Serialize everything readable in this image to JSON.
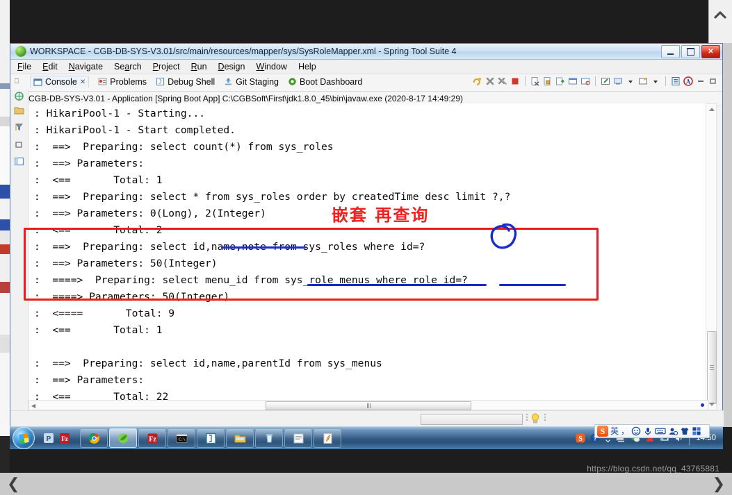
{
  "window": {
    "title": "WORKSPACE - CGB-DB-SYS-V3.01/src/main/resources/mapper/sys/SysRoleMapper.xml - Spring Tool Suite 4",
    "app_icon": "spring-leaf-icon",
    "buttons": {
      "minimize": "minimize-button",
      "restore": "restore-button",
      "close": "✕"
    }
  },
  "menubar": {
    "items": [
      {
        "label": "File",
        "mnemonic": "F"
      },
      {
        "label": "Edit",
        "mnemonic": "E"
      },
      {
        "label": "Navigate",
        "mnemonic": "N"
      },
      {
        "label": "Search",
        "mnemonic": "a"
      },
      {
        "label": "Project",
        "mnemonic": "P"
      },
      {
        "label": "Run",
        "mnemonic": "R"
      },
      {
        "label": "Design",
        "mnemonic": "D"
      },
      {
        "label": "Window",
        "mnemonic": "W"
      },
      {
        "label": "Help",
        "mnemonic": "H"
      }
    ]
  },
  "view_tabs": [
    {
      "label": "Console",
      "icon": "console-icon",
      "active": true,
      "close": "✕"
    },
    {
      "label": "Problems",
      "icon": "problems-icon",
      "active": false
    },
    {
      "label": "Debug Shell",
      "icon": "debug-shell-icon",
      "active": false
    },
    {
      "label": "Git Staging",
      "icon": "git-staging-icon",
      "active": false
    },
    {
      "label": "Boot Dashboard",
      "icon": "boot-dashboard-icon",
      "active": false
    }
  ],
  "toolbar_icons": [
    {
      "name": "relaunch-icon",
      "color": "#d9a227"
    },
    {
      "name": "terminate-icon",
      "color": "#8b8b8b"
    },
    {
      "name": "terminate-all-icon",
      "color": "#8b8b8b"
    },
    {
      "name": "stop-icon",
      "color": "#d8342a"
    },
    {
      "name": "remove-launch-icon",
      "color": "#8fa7c4"
    },
    {
      "name": "remove-all-terminated-icon",
      "color": "#d7a83a"
    },
    {
      "name": "scroll-lock-icon",
      "color": "#7ba05b"
    },
    {
      "name": "word-wrap-icon",
      "color": "#5b87c4"
    },
    {
      "name": "clear-console-icon",
      "color": "#c04a3a"
    },
    {
      "name": "pin-console-icon",
      "color": "#3f8f4d"
    },
    {
      "name": "display-selected-console-icon",
      "color": "#6b8fb8"
    },
    {
      "name": "display-dropdown-icon",
      "color": "#333333"
    },
    {
      "name": "open-console-icon",
      "color": "#d6b34a"
    },
    {
      "name": "open-console-dropdown-icon",
      "color": "#333333"
    },
    {
      "name": "view-menu-icon",
      "color": "#3a6ea5"
    },
    {
      "name": "ansi-console-icon",
      "color": "#c1272d"
    },
    {
      "name": "minimize-view-icon",
      "color": "#6a6a6a"
    },
    {
      "name": "maximize-view-icon",
      "color": "#6a6a6a"
    }
  ],
  "process_line": "CGB-DB-SYS-V3.01 - Application [Spring Boot App] C:\\CGBSoft\\First\\jdk1.8.0_45\\bin\\javaw.exe  (2020-8-17 14:49:29)",
  "console": {
    "lines": [
      ": HikariPool-1 - Starting...",
      ": HikariPool-1 - Start completed.",
      ":  ==>  Preparing: select count(*) from sys_roles",
      ":  ==> Parameters: ",
      ":  <==       Total: 1",
      ":  ==>  Preparing: select * from sys_roles order by createdTime desc limit ?,?",
      ":  ==> Parameters: 0(Long), 2(Integer)",
      ":  <==       Total: 2",
      ":  ==>  Preparing: select id,name,note from sys_roles where id=?",
      ":  ==> Parameters: 50(Integer)",
      ":  ====>  Preparing: select menu_id from sys_role_menus where role_id=?",
      ":  ====> Parameters: 50(Integer)",
      ":  <====       Total: 9",
      ":  <==       Total: 1",
      "",
      ":  ==>  Preparing: select id,name,parentId from sys_menus",
      ":  ==> Parameters: ",
      ":  <==       Total: 22"
    ]
  },
  "annotations": {
    "chinese_note": "嵌套 再查询",
    "red_box_color": "#ec1c1c",
    "blue_color": "#1b2ccc",
    "red_color": "#f21f1f",
    "blue_circle": "circle-annotation-icon",
    "underlines": [
      "id,name,note",
      "sys_role_menus",
      "role_id=?"
    ]
  },
  "ime_bar": {
    "logo": "S",
    "items": [
      {
        "name": "language-mode",
        "glyph": "英"
      },
      {
        "name": "punctuation-mode",
        "glyph": "，"
      },
      {
        "name": "emoji-panel",
        "glyph": "☺"
      },
      {
        "name": "voice-input",
        "glyph": "🎤"
      },
      {
        "name": "soft-keyboard",
        "glyph": "⌨"
      },
      {
        "name": "user-center",
        "glyph": "👤"
      },
      {
        "name": "skin-center",
        "glyph": "👕"
      },
      {
        "name": "toolbox",
        "glyph": "🧩"
      }
    ]
  },
  "taskbar": {
    "start": "start-orb-icon",
    "quick_launch": [
      {
        "name": "powerpoint-icon",
        "color": "#b7c9e3"
      },
      {
        "name": "filezilla-icon",
        "color": "#bf2026"
      }
    ],
    "tasks": [
      {
        "name": "chrome-icon",
        "active": false
      },
      {
        "name": "spring-tool-suite-icon",
        "active": true
      },
      {
        "name": "filezilla-window-icon",
        "active": false
      },
      {
        "name": "cmd-icon",
        "active": false
      },
      {
        "name": "editplus-icon",
        "active": false
      },
      {
        "name": "explorer-icon",
        "active": false
      },
      {
        "name": "recycle-bin-icon",
        "active": false
      },
      {
        "name": "notepad-icon",
        "active": false
      },
      {
        "name": "pdf-icon",
        "active": false
      }
    ],
    "tray": [
      {
        "name": "sogou-ime-tray-icon"
      },
      {
        "name": "help-tray-icon"
      },
      {
        "name": "show-hidden-icons-icon"
      },
      {
        "name": "network-tray-icon"
      },
      {
        "name": "wechat-tray-icon"
      },
      {
        "name": "antivirus-tray-icon"
      },
      {
        "name": "display-tray-icon"
      },
      {
        "name": "volume-tray-icon"
      }
    ],
    "clock": "14:50"
  },
  "watermark": "https://blog.csdn.net/qq_43765881",
  "bottom_nav": {
    "prev": "❮",
    "next": "❯"
  }
}
